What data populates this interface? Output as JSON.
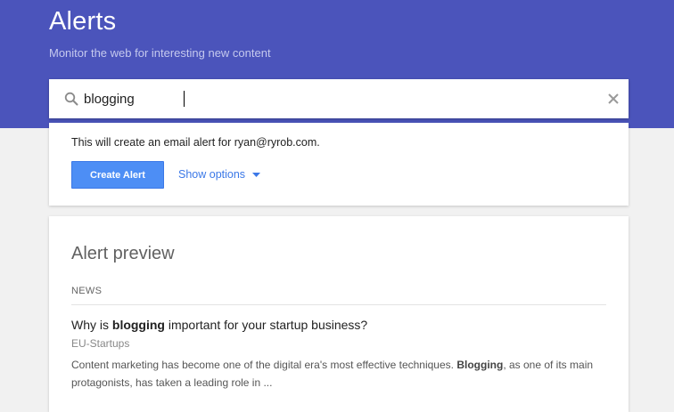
{
  "header": {
    "title": "Alerts",
    "subtitle": "Monitor the web for interesting new content"
  },
  "search": {
    "value": "blogging",
    "search_icon": "search-icon",
    "clear_icon": "close-icon"
  },
  "create_card": {
    "email_note": "This will create an email alert for ryan@ryrob.com.",
    "create_label": "Create Alert",
    "options_label": "Show options",
    "options_icon": "caret-down-icon"
  },
  "preview": {
    "title": "Alert preview",
    "section": "NEWS",
    "result": {
      "title_before": "Why is ",
      "title_bold": "blogging",
      "title_after": " important for your startup business?",
      "source": "EU-Startups",
      "snippet_before": "Content marketing has become one of the digital era's most effective techniques. ",
      "snippet_bold": "Blogging",
      "snippet_after": ", as one of its main protagonists, has taken a leading role in ..."
    }
  },
  "colors": {
    "header_bg": "#4b54bb",
    "button_bg": "#4d8ef5",
    "link": "#3b78e7",
    "page_bg": "#f1f1f1"
  }
}
